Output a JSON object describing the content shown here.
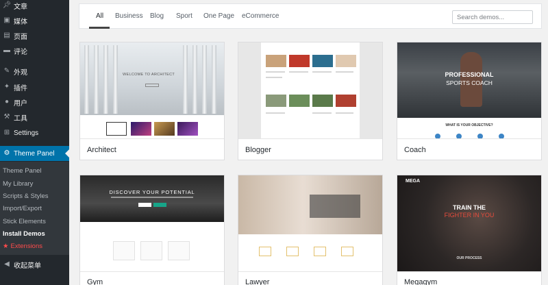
{
  "sidebar": {
    "menu": [
      {
        "label": "文章",
        "icon": "pin-icon"
      },
      {
        "label": "媒体",
        "icon": "media-icon"
      },
      {
        "label": "页面",
        "icon": "page-icon"
      },
      {
        "label": "评论",
        "icon": "comment-icon"
      },
      {
        "label": "外观",
        "icon": "brush-icon"
      },
      {
        "label": "插件",
        "icon": "plugin-icon"
      },
      {
        "label": "用户",
        "icon": "user-icon"
      },
      {
        "label": "工具",
        "icon": "wrench-icon"
      },
      {
        "label": "Settings",
        "icon": "settings-icon"
      },
      {
        "label": "Theme Panel",
        "icon": "gear-icon"
      }
    ],
    "submenu": [
      {
        "label": "Theme Panel"
      },
      {
        "label": "My Library"
      },
      {
        "label": "Scripts & Styles"
      },
      {
        "label": "Import/Export"
      },
      {
        "label": "Stick Elements"
      },
      {
        "label": "Install Demos"
      },
      {
        "label": "Extensions"
      }
    ],
    "collapse_label": "收起菜单"
  },
  "filter": {
    "tabs": [
      "All",
      "Business",
      "Blog",
      "Sport",
      "One Page",
      "eCommerce"
    ],
    "active_tab": "All",
    "search_placeholder": "Search demos..."
  },
  "demos": [
    {
      "name": "Architect",
      "hero_text": "WELCOME TO ARCHITECT"
    },
    {
      "name": "Blogger"
    },
    {
      "name": "Coach",
      "hero_line1": "PROFESSIONAL",
      "hero_line2": "SPORTS COACH",
      "question": "WHAT IS YOUR OBJECTIVE?"
    },
    {
      "name": "Gym",
      "hero_text": "DISCOVER YOUR POTENTIAL"
    },
    {
      "name": "Lawyer"
    },
    {
      "name": "Megagym",
      "logo": "MEGA",
      "hero_line1": "TRAIN THE",
      "hero_line2": "FIGHTER IN YOU",
      "section": "OUR PROCESS"
    }
  ],
  "colors": {
    "sidebar_bg": "#23282d",
    "active_item": "#0073aa",
    "extensions": "#ff4b4b",
    "megagym_accent": "#e74c3c"
  }
}
